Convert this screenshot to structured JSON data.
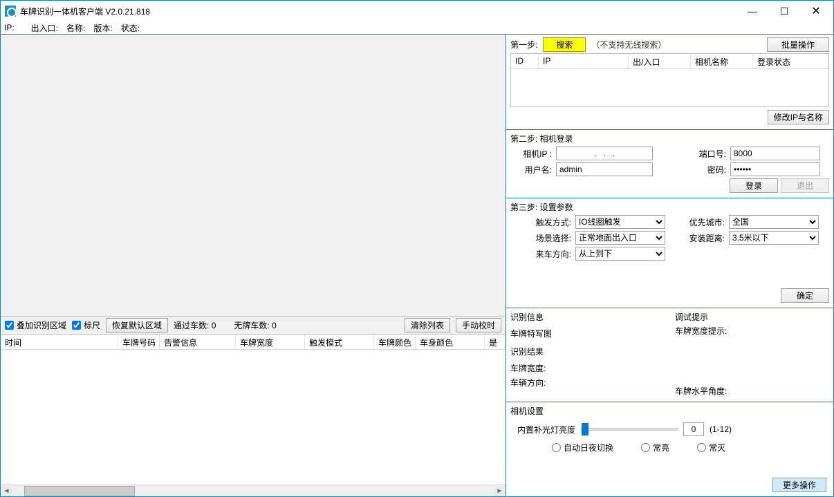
{
  "titlebar": {
    "title": "车牌识别一体机客户端 V2.0.21.818"
  },
  "infobar": {
    "ip_label": "IP:",
    "entrance_label": "出入口:",
    "name_label": "名称:",
    "version_label": "版本:",
    "status_label": "状态:"
  },
  "left_toolbar": {
    "check_overlay": "叠加识别区域",
    "check_ruler": "标尺",
    "restore_default": "恢复默认区域",
    "passed_count_label": "通过车数: ",
    "passed_count": "0",
    "noplate_count_label": "无牌车数: ",
    "noplate_count": "0",
    "clear_list": "清除列表",
    "manual_time": "手动校时"
  },
  "table_headers": {
    "time": "时间",
    "plate": "车牌号码",
    "alarm": "告警信息",
    "width": "车牌宽度",
    "trigger": "触发模式",
    "pcolor": "车牌颜色",
    "bcolor": "车身颜色",
    "more": "是"
  },
  "step1": {
    "label": "第一步:",
    "search": "搜索",
    "note": "（不支持无线搜索）",
    "batch": "批量操作",
    "headers": {
      "id": "ID",
      "ip": "IP",
      "io": "出/入口",
      "cam": "相机名称",
      "login": "登录状态"
    },
    "modify": "修改IP与名称"
  },
  "step2": {
    "label": "第二步: 相机登录",
    "cam_ip": "相机IP :",
    "cam_ip_value": "   .   .   .   ",
    "port": "端口号:",
    "port_value": "8000",
    "user": "用户名:",
    "user_value": "admin",
    "pwd": "密码:",
    "login": "登录",
    "logout": "退出"
  },
  "step3": {
    "label": "第三步: 设置参数",
    "trigger": "触发方式:",
    "trigger_value": "IO线圈触发",
    "city": "优先城市:",
    "city_value": "全国",
    "scene": "场景选择:",
    "scene_value": "正常地面出入口",
    "distance": "安装距离:",
    "distance_value": "3.5米以下",
    "direction": "来车方向:",
    "direction_value": "从上到下",
    "confirm": "确定"
  },
  "recog": {
    "title_left": "识别信息",
    "title_right": "调试提示",
    "closeup": "车牌特写图",
    "width_hint": "车牌宽度提示:",
    "result": "识别结果",
    "width": "车牌宽度:",
    "dir": "车辆方向:",
    "angle": "车牌水平角度:"
  },
  "cam_set": {
    "title": "相机设置",
    "fill_light": "内置补光灯亮度",
    "value": "0",
    "range": "(1-12)",
    "r1": "自动日夜切换",
    "r2": "常亮",
    "r3": "常灭",
    "more": "更多操作"
  }
}
